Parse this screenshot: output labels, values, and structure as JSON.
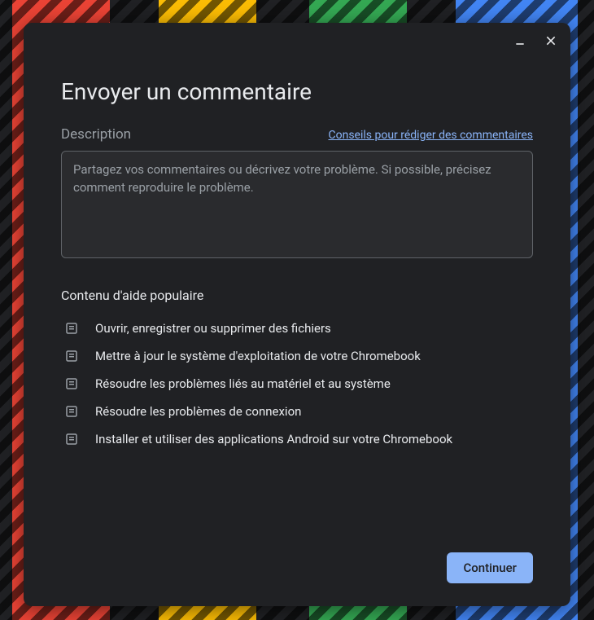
{
  "dialog": {
    "title": "Envoyer un commentaire",
    "descriptionLabel": "Description",
    "tipsLink": "Conseils pour rédiger des commentaires",
    "textareaPlaceholder": "Partagez vos commentaires ou décrivez votre problème. Si possible, précisez comment reproduire le problème.",
    "textareaValue": "",
    "popularHelpHeading": "Contenu d'aide populaire",
    "helpItems": [
      "Ouvrir, enregistrer ou supprimer des fichiers",
      "Mettre à jour le système d'exploitation de votre Chromebook",
      "Résoudre les problèmes liés au matériel et au système",
      "Résoudre les problèmes de connexion",
      "Installer et utiliser des applications Android sur votre Chromebook"
    ],
    "continueLabel": "Continuer"
  }
}
